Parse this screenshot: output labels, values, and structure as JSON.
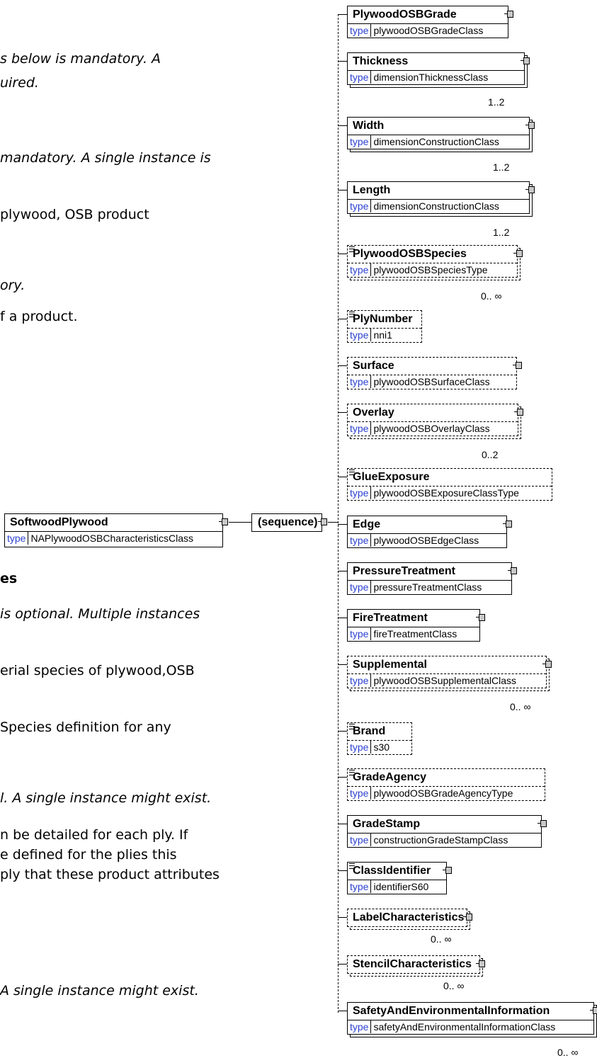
{
  "left_text": [
    {
      "text": "s below is mandatory. A",
      "style": "italic"
    },
    {
      "text": "uired.",
      "style": "italic"
    },
    {
      "text": "mandatory. A single instance is",
      "style": "italic"
    },
    {
      "text": "plywood, OSB product",
      "style": "normal"
    },
    {
      "text": "ory.",
      "style": "italic"
    },
    {
      "text": "f a product.",
      "style": "normal"
    },
    {
      "text": "es",
      "style": "bold"
    },
    {
      "text": "is optional. Multiple instances",
      "style": "italic"
    },
    {
      "text": "erial species of plywood,OSB",
      "style": "normal"
    },
    {
      "text": "Species definition for any",
      "style": "normal"
    },
    {
      "text": "l. A single instance might exist.",
      "style": "italic"
    },
    {
      "text": "n be detailed for each ply. If",
      "style": "normal"
    },
    {
      "text": "e defined for the plies this",
      "style": "normal"
    },
    {
      "text": "ply that these product attributes",
      "style": "normal"
    },
    {
      "text": "A single instance might exist.",
      "style": "italic"
    }
  ],
  "root": {
    "name": "SoftwoodPlywood",
    "type_keyword": "type",
    "type": "NAPlywoodOSBCharacteristicsClass"
  },
  "sequence_label": "(sequence)",
  "elements": [
    {
      "name": "PlywoodOSBGrade",
      "type_keyword": "type",
      "type": "plywoodOSBGradeClass",
      "cardinality": ""
    },
    {
      "name": "Thickness",
      "type_keyword": "type",
      "type": "dimensionThicknessClass",
      "cardinality": "1..2"
    },
    {
      "name": "Width",
      "type_keyword": "type",
      "type": "dimensionConstructionClass",
      "cardinality": "1..2"
    },
    {
      "name": "Length",
      "type_keyword": "type",
      "type": "dimensionConstructionClass",
      "cardinality": "1..2"
    },
    {
      "name": "PlywoodOSBSpecies",
      "type_keyword": "type",
      "type": "plywoodOSBSpeciesType",
      "cardinality": "0.. ∞"
    },
    {
      "name": "PlyNumber",
      "type_keyword": "type",
      "type": "nni1",
      "cardinality": ""
    },
    {
      "name": "Surface",
      "type_keyword": "type",
      "type": "plywoodOSBSurfaceClass",
      "cardinality": ""
    },
    {
      "name": "Overlay",
      "type_keyword": "type",
      "type": "plywoodOSBOverlayClass",
      "cardinality": "0..2"
    },
    {
      "name": "GlueExposure",
      "type_keyword": "type",
      "type": "plywoodOSBExposureClassType",
      "cardinality": ""
    },
    {
      "name": "Edge",
      "type_keyword": "type",
      "type": "plywoodOSBEdgeClass",
      "cardinality": ""
    },
    {
      "name": "PressureTreatment",
      "type_keyword": "type",
      "type": "pressureTreatmentClass",
      "cardinality": ""
    },
    {
      "name": "FireTreatment",
      "type_keyword": "type",
      "type": "fireTreatmentClass",
      "cardinality": ""
    },
    {
      "name": "Supplemental",
      "type_keyword": "type",
      "type": "plywoodOSBSupplementalClass",
      "cardinality": "0.. ∞"
    },
    {
      "name": "Brand",
      "type_keyword": "type",
      "type": "s30",
      "cardinality": ""
    },
    {
      "name": "GradeAgency",
      "type_keyword": "type",
      "type": "plywoodOSBGradeAgencyType",
      "cardinality": ""
    },
    {
      "name": "GradeStamp",
      "type_keyword": "type",
      "type": "constructionGradeStampClass",
      "cardinality": ""
    },
    {
      "name": "ClassIdentifier",
      "type_keyword": "type",
      "type": "identifierS60",
      "cardinality": ""
    },
    {
      "name": "LabelCharacteristics",
      "type_keyword": "",
      "type": "",
      "cardinality": "0.. ∞"
    },
    {
      "name": "StencilCharacteristics",
      "type_keyword": "",
      "type": "",
      "cardinality": "0.. ∞"
    },
    {
      "name": "SafetyAndEnvironmentalInformation",
      "type_keyword": "type",
      "type": "safetyAndEnvironmentalInformationClass",
      "cardinality": "0.. ∞"
    }
  ]
}
